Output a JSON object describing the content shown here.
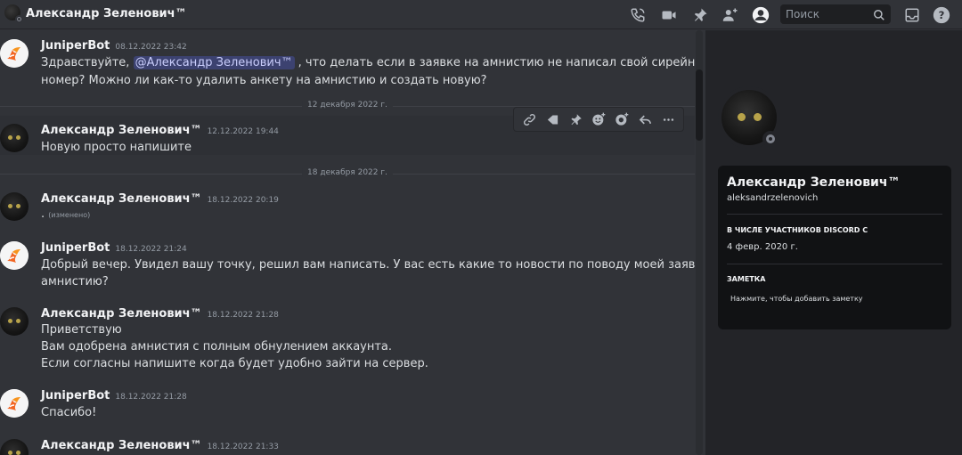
{
  "header": {
    "title": "Александр Зеленович™",
    "search_placeholder": "Поиск"
  },
  "icons": {
    "call": "phone-call-icon",
    "video": "video-icon",
    "pins": "pin-icon",
    "add_friend": "add-member-icon",
    "profile": "user-profile-icon",
    "inbox": "inbox-icon",
    "help": "help-icon"
  },
  "messages": [
    {
      "author": "JuniperBot",
      "time": "08.12.2022 23:42",
      "line1_pre": "Здравствуйте,",
      "mention": "@Александр Зеленович™",
      "line1_post": ", что делать если в заявке на амнистию не написал свой сирейный",
      "line2": "номер? Можно ли как-то удалить  анкету на амнистию и создать новую?"
    },
    {
      "author": "Александр Зеленович™",
      "time": "12.12.2022 19:44",
      "line1": "Новую просто напишите"
    },
    {
      "author": "Александр Зеленович™",
      "time": "18.12.2022 20:19",
      "line1": ".",
      "edited": "(изменено)"
    },
    {
      "author": "JuniperBot",
      "time": "18.12.2022 21:24",
      "line1": "Добрый вечер. Увидел вашу точку, решил вам написать. У вас есть какие то новости по поводу моей заявки на",
      "line2": "амнистию?"
    },
    {
      "author": "Александр Зеленович™",
      "time": "18.12.2022 21:28",
      "line1": "Приветствую",
      "line2": "Вам одобрена амнистия с полным обнулением аккаунта.",
      "line3": "Если согласны напишите когда будет удобно зайти на сервер."
    },
    {
      "author": "JuniperBot",
      "time": "18.12.2022 21:28",
      "line1": "Спасибо!"
    },
    {
      "author": "Александр Зеленович™",
      "time": "18.12.2022 21:33"
    }
  ],
  "dividers": [
    "12 декабря 2022 г.",
    "18 декабря 2022 г."
  ],
  "profile": {
    "display_name": "Александр Зеленович™",
    "username": "aleksandrzelenovich",
    "member_since_label": "В ЧИСЛЕ УЧАСТНИКОВ DISCORD С",
    "member_since": "4 февр. 2020 г.",
    "note_label": "ЗАМЕТКА",
    "note_placeholder": "Нажмите, чтобы добавить заметку"
  }
}
